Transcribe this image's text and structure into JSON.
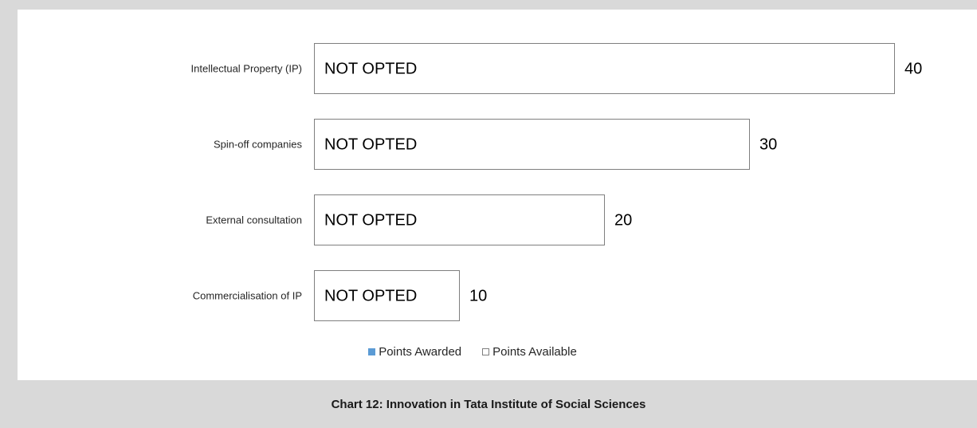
{
  "chart_data": {
    "type": "bar",
    "orientation": "horizontal",
    "categories": [
      "Intellectual Property (IP)",
      "Spin-off companies",
      "External consultation",
      "Commercialisation of IP"
    ],
    "series": [
      {
        "name": "Points Awarded",
        "values": [
          null,
          null,
          null,
          null
        ],
        "color": "#5b9bd5"
      },
      {
        "name": "Points Available",
        "values": [
          40,
          30,
          20,
          10
        ],
        "color": "#ffffff"
      }
    ],
    "bar_text": [
      "NOT OPTED",
      "NOT OPTED",
      "NOT OPTED",
      "NOT OPTED"
    ],
    "data_labels": [
      "40",
      "30",
      "20",
      "10"
    ],
    "xlim": [
      0,
      40
    ],
    "grid": false,
    "legend_position": "bottom",
    "legend": [
      "Points Awarded",
      "Points Available"
    ]
  },
  "caption": "Chart 12: Innovation in Tata Institute of Social Sciences"
}
